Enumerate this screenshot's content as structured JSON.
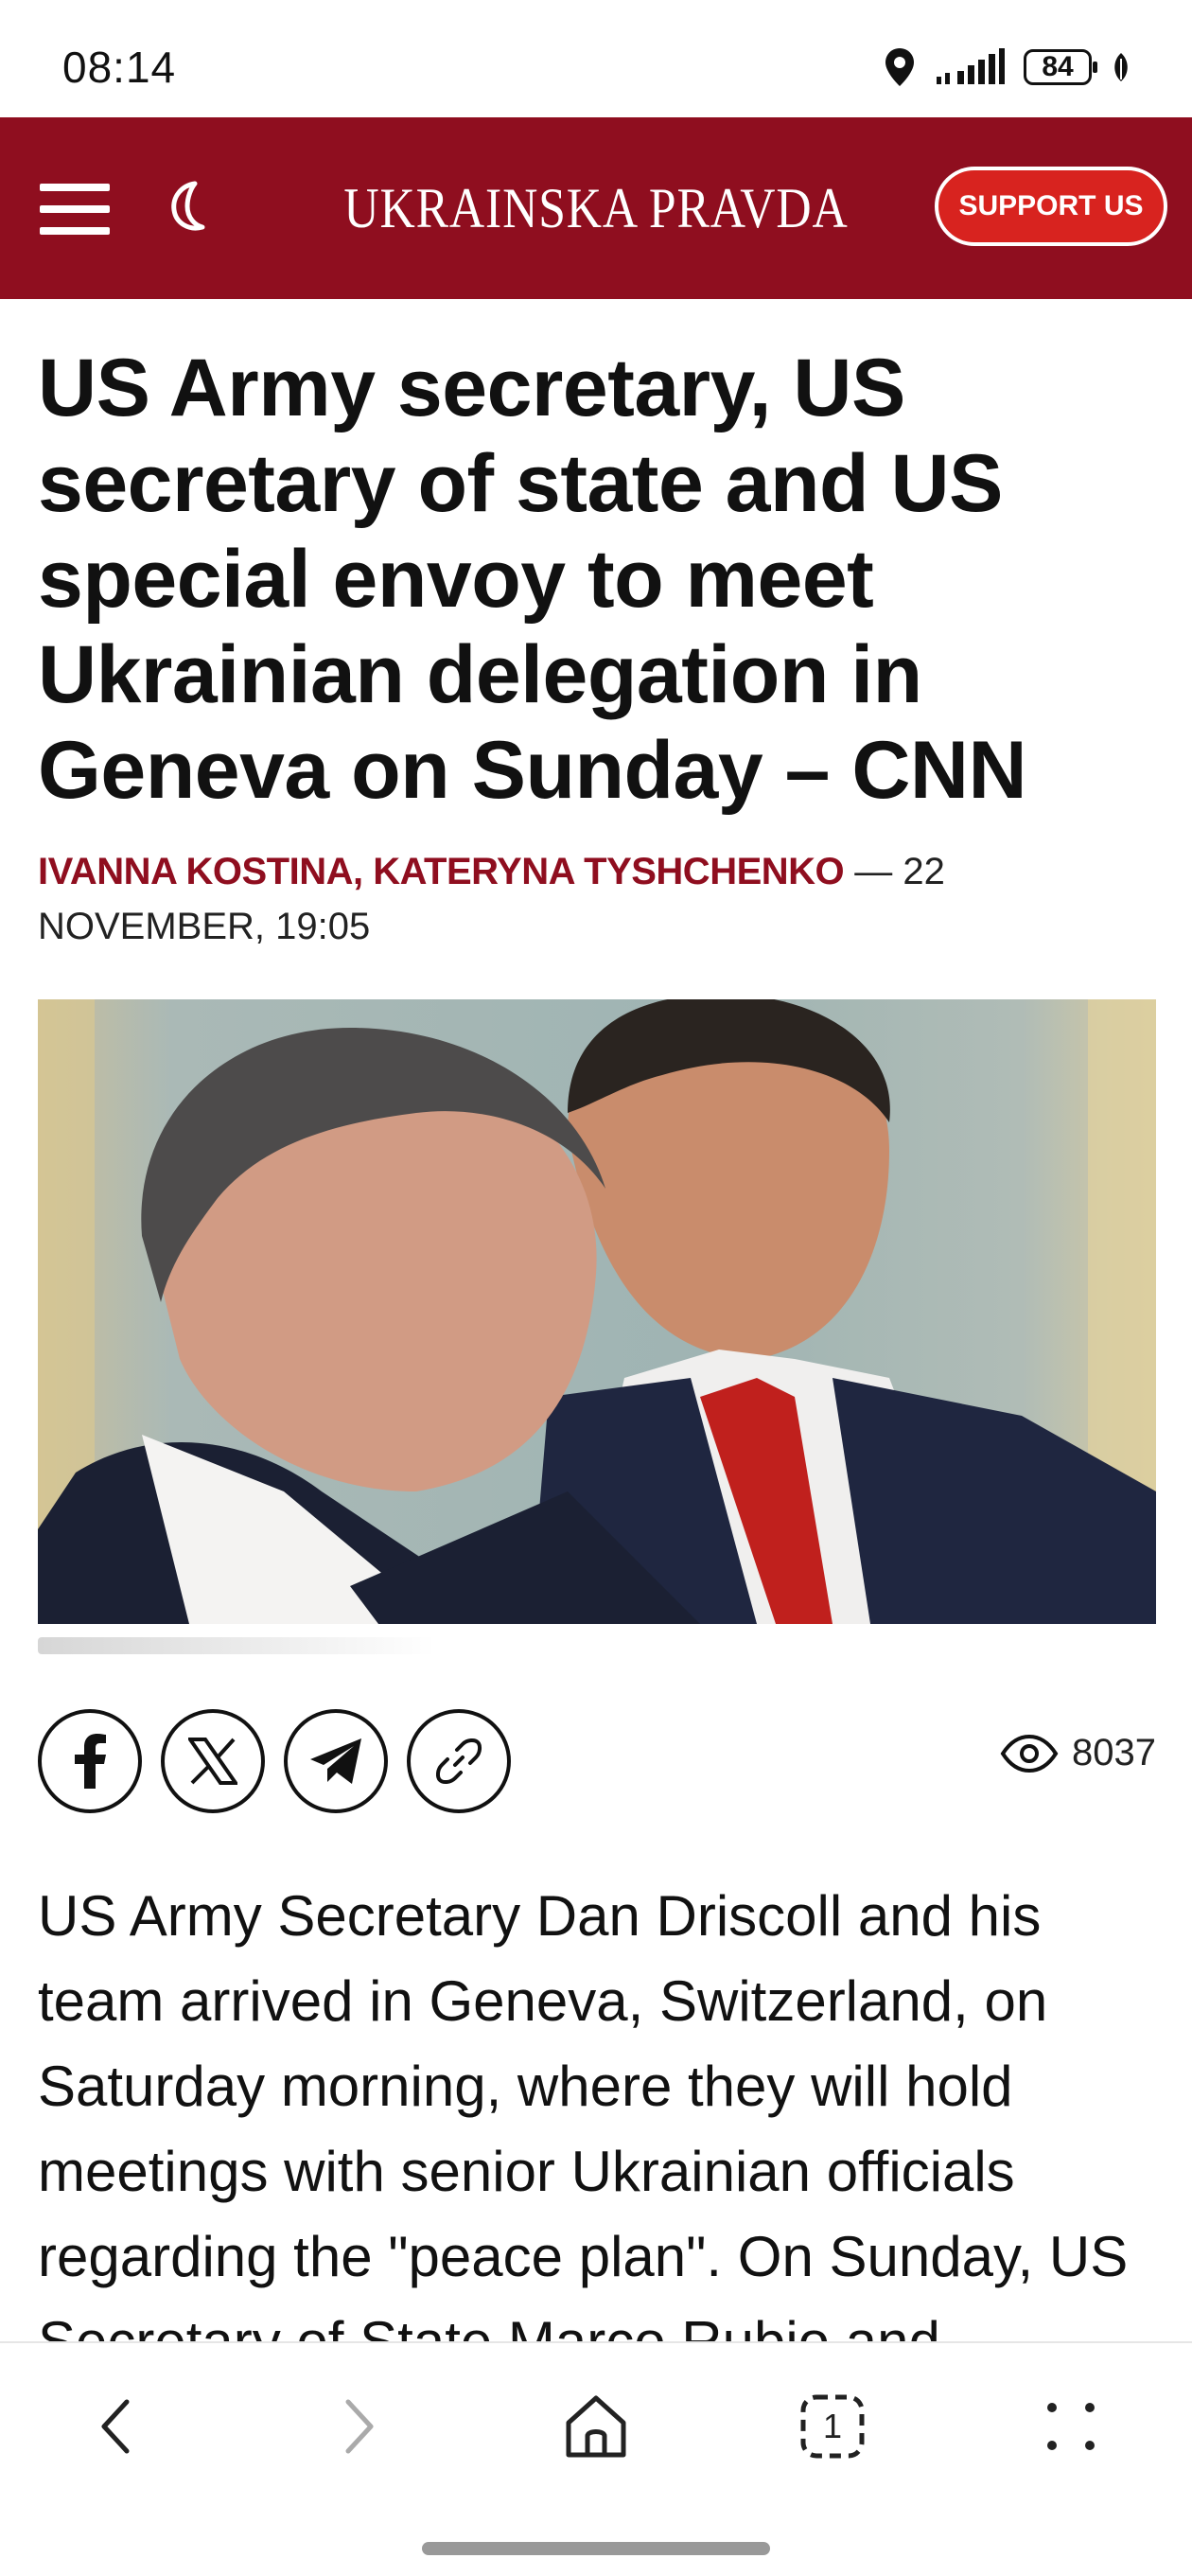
{
  "status_bar": {
    "time": "08:14",
    "battery": "84"
  },
  "header": {
    "brand": "UKRAINSKA PRAVDA",
    "support_label": "SUPPORT US",
    "background_color": "#8f0e1f",
    "support_color": "#d8231f"
  },
  "article": {
    "headline": "US Army secretary, US secretary of state and US special envoy to meet Ukrainian delegation in Geneva on Sunday – CNN",
    "authors": "IVANNA KOSTINA, KATERYNA TYSHCHENKO",
    "date": " — 22 NOVEMBER, 19:05",
    "views": "8037",
    "body": "US Army Secretary Dan Driscoll and his team arrived in Geneva, Switzerland, on Saturday morning, where they will hold meetings with senior Ukrainian officials regarding the \"peace plan\". On Sunday, US Secretary of State Marco Rubio and"
  },
  "share": {
    "icons": [
      "facebook-icon",
      "x-icon",
      "telegram-icon",
      "link-icon"
    ]
  },
  "bottom_nav": {
    "tabs_count": "1",
    "icons": [
      "back-icon",
      "forward-icon",
      "home-icon",
      "tabs-icon",
      "more-icon"
    ]
  }
}
